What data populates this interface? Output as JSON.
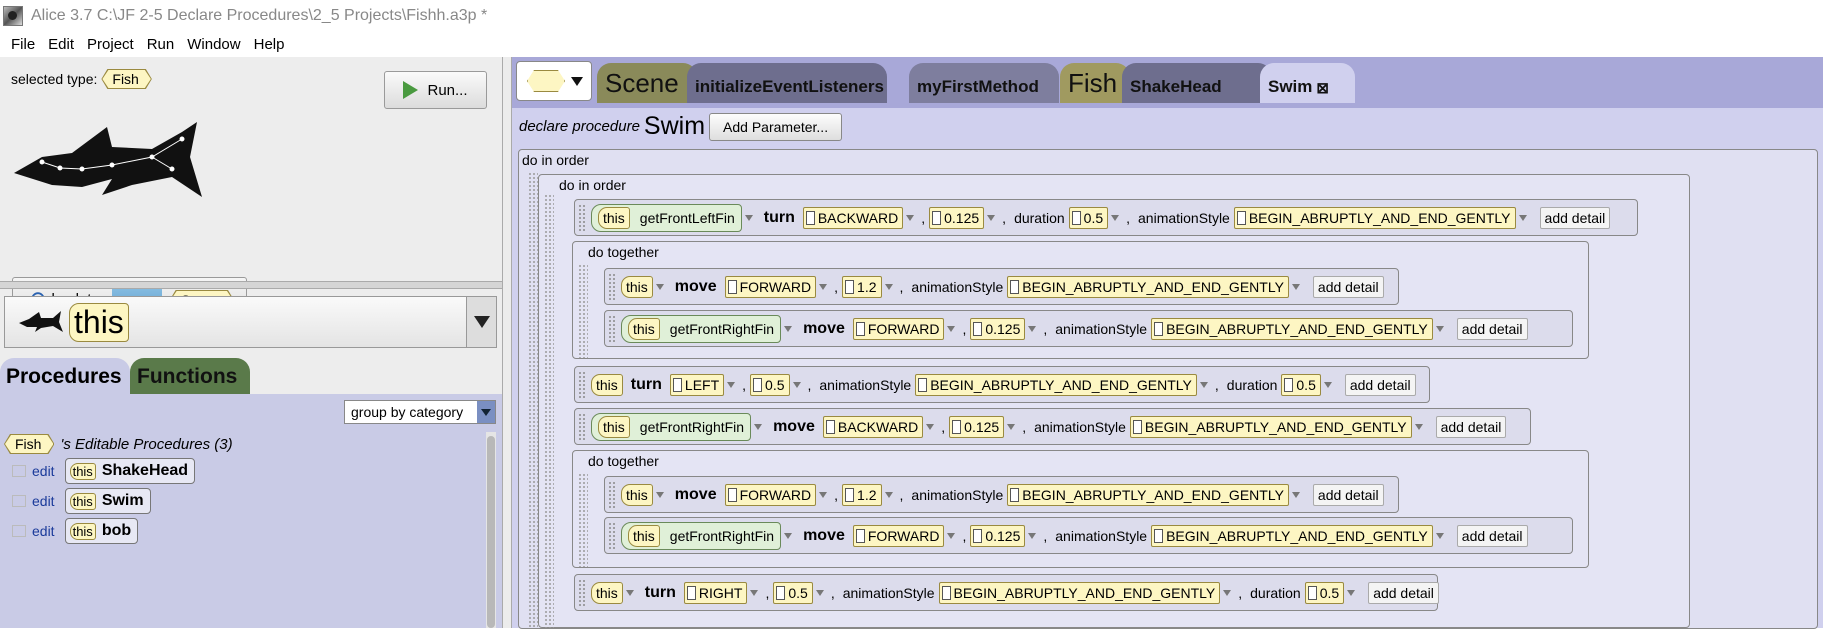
{
  "window": {
    "title": "Alice 3.7 C:\\JF 2-5 Declare Procedures\\2_5 Projects\\Fishh.a3p *"
  },
  "menu": [
    "File",
    "Edit",
    "Project",
    "Run",
    "Window",
    "Help"
  ],
  "left": {
    "selected_type_label": "selected type:",
    "selected_type": "Fish",
    "run_label": "Run...",
    "back_label": "back to:",
    "back_target": "Scene",
    "this_label": "this",
    "tabs": {
      "procedures": "Procedures",
      "functions": "Functions"
    },
    "group_by": "group by category",
    "editable_type": "Fish",
    "editable_header": "'s Editable Procedures (3)",
    "procedures": [
      {
        "edit": "edit",
        "this": "this",
        "name": "ShakeHead"
      },
      {
        "edit": "edit",
        "this": "this",
        "name": "Swim"
      },
      {
        "edit": "edit",
        "this": "this",
        "name": "bob"
      }
    ]
  },
  "editor": {
    "tabs": [
      "Scene",
      "initializeEventListeners",
      "myFirstMethod",
      "Fish",
      "ShakeHead",
      "Swim"
    ],
    "declare_label": "declare procedure",
    "proc_name": "Swim",
    "add_param": "Add Parameter...",
    "do_in_order": "do in order",
    "do_together": "do together",
    "this": "this",
    "get_left_fin": "getFrontLeftFin",
    "get_right_fin": "getFrontRightFin",
    "turn": "turn",
    "move": "move",
    "backward": "BACKWARD",
    "forward": "FORWARD",
    "left": "LEFT",
    "right": "RIGHT",
    "v0125": "0.125",
    "v05": "0.5",
    "v12": "1.2",
    "duration": "duration",
    "anim_style": "animationStyle",
    "anim_value": "BEGIN_ABRUPTLY_AND_END_GENTLY",
    "add_detail": "add detail",
    "comma": ","
  },
  "colors": {
    "editor_bg": "#d0d0ee",
    "tab_scene": "#8a8a5a",
    "tab_fish": "#a09a60",
    "tab_method": "#6e6e8e",
    "literal": "#fdf6c3"
  }
}
